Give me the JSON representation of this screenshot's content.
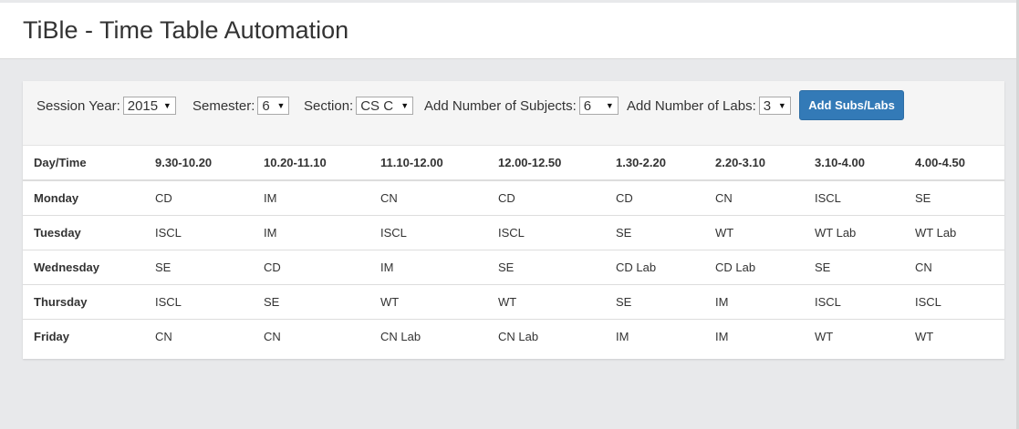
{
  "header": {
    "title": "TiBle - Time Table Automation"
  },
  "controls": {
    "session_year": {
      "label": "Session Year:",
      "value": "2015"
    },
    "semester": {
      "label": "Semester:",
      "value": "6"
    },
    "section": {
      "label": "Section:",
      "value": "CS C"
    },
    "subjects": {
      "label": "Add Number of Subjects:",
      "value": "6"
    },
    "labs": {
      "label": "Add Number of Labs:",
      "value": "3"
    },
    "add_button": "Add Subs/Labs"
  },
  "table": {
    "headers": [
      "Day/Time",
      "9.30-10.20",
      "10.20-11.10",
      "11.10-12.00",
      "12.00-12.50",
      "1.30-2.20",
      "2.20-3.10",
      "3.10-4.00",
      "4.00-4.50"
    ],
    "rows": [
      [
        "Monday",
        "CD",
        "IM",
        "CN",
        "CD",
        "CD",
        "CN",
        "ISCL",
        "SE"
      ],
      [
        "Tuesday",
        "ISCL",
        "IM",
        "ISCL",
        "ISCL",
        "SE",
        "WT",
        "WT Lab",
        "WT Lab"
      ],
      [
        "Wednesday",
        "SE",
        "CD",
        "IM",
        "SE",
        "CD Lab",
        "CD Lab",
        "SE",
        "CN"
      ],
      [
        "Thursday",
        "ISCL",
        "SE",
        "WT",
        "WT",
        "SE",
        "IM",
        "ISCL",
        "ISCL"
      ],
      [
        "Friday",
        "CN",
        "CN",
        "CN Lab",
        "CN Lab",
        "IM",
        "IM",
        "WT",
        "WT"
      ]
    ]
  },
  "icons": {
    "dropdown": "dropdown-arrow-icon"
  }
}
